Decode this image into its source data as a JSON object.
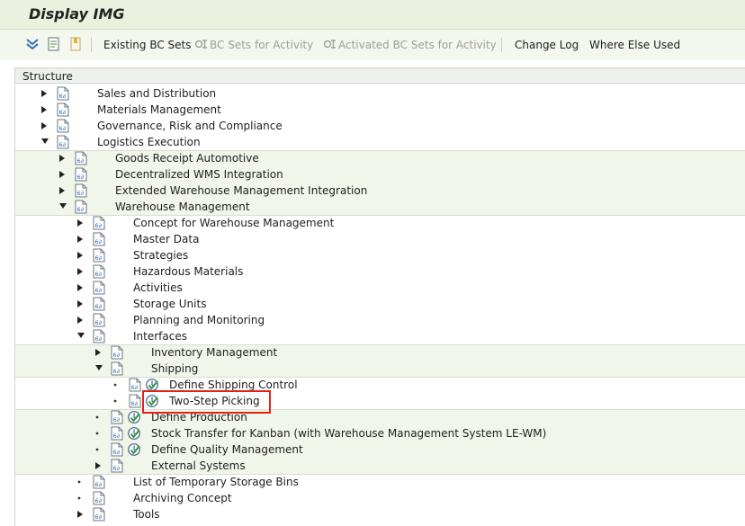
{
  "window": {
    "title": "Display IMG"
  },
  "toolbar": {
    "icons": [
      "expand-subtree-icon",
      "find-icon",
      "bookmark-icon"
    ],
    "buttons": [
      {
        "id": "existing-bc-sets",
        "label": "Existing BC Sets",
        "enabled": true
      },
      {
        "id": "bc-sets-activity",
        "label": "BC Sets for Activity",
        "enabled": false
      },
      {
        "id": "activated-bc-sets",
        "label": "Activated BC Sets for Activity",
        "enabled": false
      },
      {
        "id": "change-log",
        "label": "Change Log",
        "enabled": true
      },
      {
        "id": "where-else-used",
        "label": "Where Else Used",
        "enabled": true
      }
    ]
  },
  "tree": {
    "header": "Structure",
    "highlighted_item": "Two-Step Picking",
    "bands": [
      "#f1f6ea",
      "#ffffff",
      "#f1f6ea",
      "#ffffff",
      "#f1f6ea"
    ],
    "rows": [
      {
        "label": "Sales and Distribution",
        "level": 0,
        "state": "collapsed",
        "activity": false
      },
      {
        "label": "Materials Management",
        "level": 0,
        "state": "collapsed",
        "activity": false
      },
      {
        "label": "Governance, Risk and Compliance",
        "level": 0,
        "state": "collapsed",
        "activity": false
      },
      {
        "label": "Logistics Execution",
        "level": 0,
        "state": "expanded",
        "activity": false
      },
      {
        "label": "Goods Receipt Automotive",
        "level": 1,
        "state": "collapsed",
        "activity": false
      },
      {
        "label": "Decentralized WMS Integration",
        "level": 1,
        "state": "collapsed",
        "activity": false
      },
      {
        "label": "Extended Warehouse Management Integration",
        "level": 1,
        "state": "collapsed",
        "activity": false
      },
      {
        "label": "Warehouse Management",
        "level": 1,
        "state": "expanded",
        "activity": false
      },
      {
        "label": "Concept for Warehouse Management",
        "level": 2,
        "state": "collapsed",
        "activity": false
      },
      {
        "label": "Master Data",
        "level": 2,
        "state": "collapsed",
        "activity": false
      },
      {
        "label": "Strategies",
        "level": 2,
        "state": "collapsed",
        "activity": false
      },
      {
        "label": "Hazardous Materials",
        "level": 2,
        "state": "collapsed",
        "activity": false
      },
      {
        "label": "Activities",
        "level": 2,
        "state": "collapsed",
        "activity": false
      },
      {
        "label": "Storage Units",
        "level": 2,
        "state": "collapsed",
        "activity": false
      },
      {
        "label": "Planning and Monitoring",
        "level": 2,
        "state": "collapsed",
        "activity": false
      },
      {
        "label": "Interfaces",
        "level": 2,
        "state": "expanded",
        "activity": false
      },
      {
        "label": "Inventory Management",
        "level": 3,
        "state": "collapsed",
        "activity": false
      },
      {
        "label": "Shipping",
        "level": 3,
        "state": "expanded",
        "activity": false
      },
      {
        "label": "Define Shipping Control",
        "level": 4,
        "state": "leaf",
        "activity": true
      },
      {
        "label": "Two-Step Picking",
        "level": 4,
        "state": "leaf",
        "activity": true
      },
      {
        "label": "Define Production",
        "level": 3,
        "state": "leaf",
        "activity": true
      },
      {
        "label": "Stock Transfer for Kanban (with Warehouse Management System LE-WM)",
        "level": 3,
        "state": "leaf",
        "activity": true
      },
      {
        "label": "Define Quality Management",
        "level": 3,
        "state": "leaf",
        "activity": true
      },
      {
        "label": "External Systems",
        "level": 3,
        "state": "collapsed",
        "activity": false
      },
      {
        "label": "List of Temporary Storage Bins",
        "level": 2,
        "state": "leaf",
        "activity": false
      },
      {
        "label": "Archiving Concept",
        "level": 2,
        "state": "leaf",
        "activity": false
      },
      {
        "label": "Tools",
        "level": 2,
        "state": "collapsed",
        "activity": false
      }
    ]
  }
}
